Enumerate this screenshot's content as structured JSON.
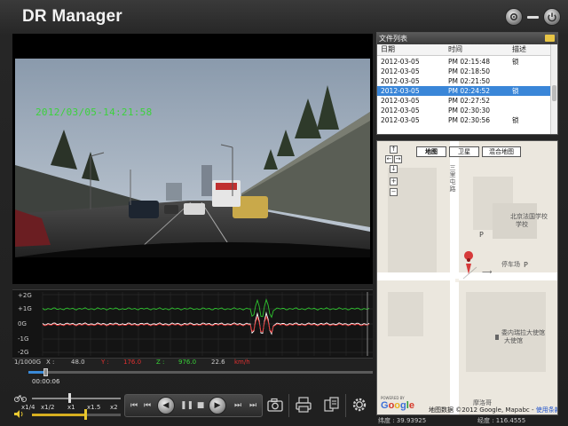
{
  "app": {
    "title": "DR Manager"
  },
  "video": {
    "timestamp": "2012/03/05-14:21:58"
  },
  "file_list": {
    "title": "文件列表",
    "columns": {
      "date": "日期",
      "time": "时间",
      "desc": "描述"
    },
    "rows": [
      {
        "date": "2012-03-05",
        "time": "PM 02:15:48",
        "desc": "锁",
        "selected": false
      },
      {
        "date": "2012-03-05",
        "time": "PM 02:18:50",
        "desc": "",
        "selected": false
      },
      {
        "date": "2012-03-05",
        "time": "PM 02:21:50",
        "desc": "",
        "selected": false
      },
      {
        "date": "2012-03-05",
        "time": "PM 02:24:52",
        "desc": "锁",
        "selected": true
      },
      {
        "date": "2012-03-05",
        "time": "PM 02:27:52",
        "desc": "",
        "selected": false
      },
      {
        "date": "2012-03-05",
        "time": "PM 02:30:30",
        "desc": "",
        "selected": false
      },
      {
        "date": "2012-03-05",
        "time": "PM 02:30:56",
        "desc": "锁",
        "selected": false
      }
    ]
  },
  "map": {
    "tabs": [
      {
        "label": "地图",
        "active": true
      },
      {
        "label": "卫星",
        "active": false
      },
      {
        "label": "混合地图",
        "active": false
      }
    ],
    "labels": {
      "street": "三里屯路",
      "school": "北京法国学校",
      "school_line2": "学校",
      "parking": "停车场",
      "embassy": "委内瑞拉大使馆",
      "embassy_line2": "大使馆",
      "bottom": "摩洛哥"
    },
    "attribution": "地图数据 ©2012 Google, Mapabc - ",
    "terms_link": "使用条款",
    "logo": "Google",
    "powered_by": "POWERED BY"
  },
  "graph": {
    "y_labels": [
      "+2G",
      "+1G",
      "0G",
      "-1G",
      "-2G"
    ],
    "readout": {
      "scale": "1/1000G",
      "x_label": "X :",
      "x_value": "48.0",
      "y_label": "Y :",
      "y_value": "176.0",
      "z_label": "Z :",
      "z_value": "976.0",
      "speed_value": "22.6",
      "speed_unit": "km/h"
    },
    "elapsed": "00:00:06",
    "progress": 0.05
  },
  "speed": {
    "options": [
      "x1/4",
      "x1/2",
      "x1",
      "x1.5",
      "x2"
    ],
    "selected": "x1",
    "volume": 0.6
  },
  "coords": {
    "lat_label": "纬度 : 39.93925",
    "lon_label": "经度 : 116.4555"
  },
  "colors": {
    "accent": "#3a86d8",
    "graph_green": "#2ec42e",
    "graph_red": "#e02a2a",
    "graph_white": "#ffffff",
    "readout_red": "#e03030",
    "readout_green": "#38d038",
    "timestamp_green": "#3cd23c"
  }
}
